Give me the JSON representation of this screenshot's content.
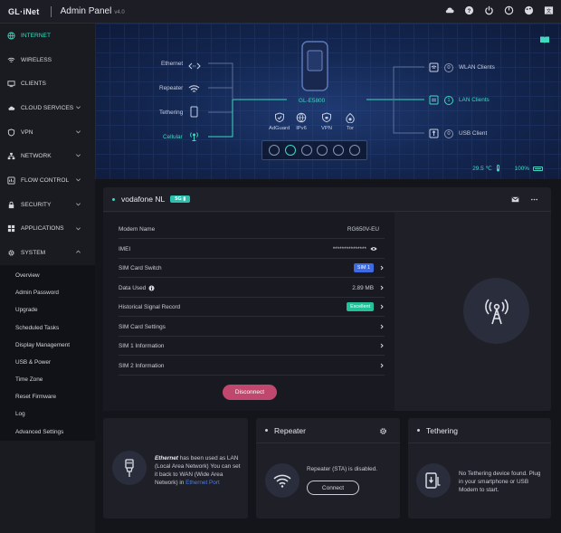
{
  "topbar": {
    "logo": "GL·iNet",
    "title": "Admin Panel",
    "version": "v4.0"
  },
  "sidebar": {
    "items": [
      {
        "label": "INTERNET",
        "icon": "globe-icon",
        "active": true
      },
      {
        "label": "WIRELESS",
        "icon": "wifi-icon"
      },
      {
        "label": "CLIENTS",
        "icon": "clients-icon"
      },
      {
        "label": "CLOUD SERVICES",
        "icon": "cloud-icon"
      },
      {
        "label": "VPN",
        "icon": "shield-icon"
      },
      {
        "label": "NETWORK",
        "icon": "network-icon"
      },
      {
        "label": "FLOW CONTROL",
        "icon": "flow-icon"
      },
      {
        "label": "SECURITY",
        "icon": "lock-icon"
      },
      {
        "label": "APPLICATIONS",
        "icon": "apps-icon"
      },
      {
        "label": "SYSTEM",
        "icon": "gear-icon"
      }
    ],
    "system_sub": [
      "Overview",
      "Admin Password",
      "Upgrade",
      "Scheduled Tasks",
      "Display Management",
      "USB & Power",
      "Time Zone",
      "Reset Firmware",
      "Log",
      "Advanced Settings"
    ]
  },
  "hero": {
    "sources": {
      "ethernet": "Ethernet",
      "repeater": "Repeater",
      "tethering": "Tethering",
      "cellular": "Cellular"
    },
    "device": "GL-E5800",
    "services": [
      "AdGuard",
      "IPv6",
      "VPN",
      "Tor"
    ],
    "clients": [
      {
        "count": "0",
        "label": "WLAN Clients"
      },
      {
        "count": "1",
        "label": "LAN Clients"
      },
      {
        "count": "0",
        "label": "USB Client"
      }
    ],
    "temperature": "29.5 ℃",
    "battery": "100%"
  },
  "cellular": {
    "carrier": "vodafone NL",
    "badge": "5G",
    "rows": {
      "modem_name": {
        "label": "Modem Name",
        "value": "RG650V-EU"
      },
      "imei": {
        "label": "IMEI",
        "value": "***************"
      },
      "sim_switch": {
        "label": "SIM Card Switch",
        "value": "SIM 1"
      },
      "data_used": {
        "label": "Data Used",
        "value": "2.89 MB"
      },
      "signal": {
        "label": "Historical Signal Record",
        "value": "Excellent"
      },
      "sim_settings": {
        "label": "SIM Card Settings"
      },
      "sim1": {
        "label": "SIM 1 Information"
      },
      "sim2": {
        "label": "SIM 2 Information"
      }
    },
    "disconnect": "Disconnect"
  },
  "cards": {
    "ethernet": {
      "bold": "Ethernet",
      "text": " has been used as LAN (Local Area Network) You can set it back to WAN (Wide Area Network) in ",
      "link": "Ethernet Port"
    },
    "repeater": {
      "title": "Repeater",
      "status": "Repeater (STA) is disabled.",
      "button": "Connect"
    },
    "tethering": {
      "title": "Tethering",
      "status": "No Tethering device found. Plug in your smartphone or USB Modem to start."
    }
  },
  "colors": {
    "accent": "#3fd8c0",
    "danger": "#c0476d",
    "link": "#4d7de6"
  }
}
